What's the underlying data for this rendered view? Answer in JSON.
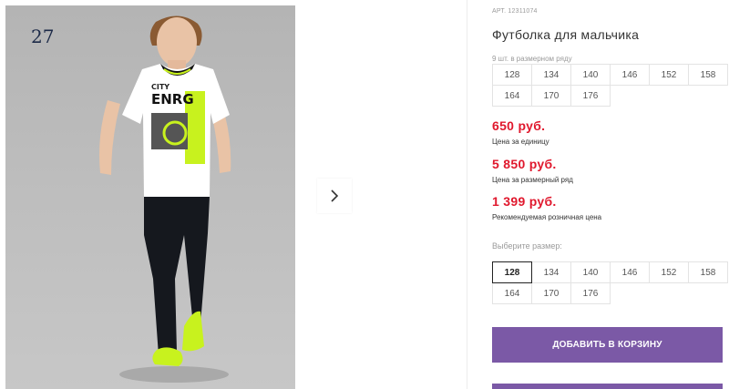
{
  "gallery": {
    "counter": "27",
    "shirt_print": "CITY ENRG"
  },
  "product": {
    "sku": "АРТ. 12311074",
    "title": "Футболка для мальчика",
    "row_note": "9 шт. в размерном ряду",
    "row_sizes": [
      "128",
      "134",
      "140",
      "146",
      "152",
      "158",
      "164",
      "170",
      "176"
    ],
    "prices": [
      {
        "value": "650 руб.",
        "label": "Цена за единицу"
      },
      {
        "value": "5 850 руб.",
        "label": "Цена за размерный ряд"
      },
      {
        "value": "1 399 руб.",
        "label": "Рекомендуемая розничная цена"
      }
    ],
    "choose_size_label": "Выберите размер:",
    "select_sizes": [
      "128",
      "134",
      "140",
      "146",
      "152",
      "158",
      "164",
      "170",
      "176"
    ],
    "selected_size": "128",
    "add_to_cart": "ДОБАВИТЬ В КОРЗИНУ"
  },
  "colors": {
    "price": "#e0182d",
    "button": "#7b59a6",
    "accent_neon": "#c8f21e"
  },
  "icons": {
    "next": "chevron-right-icon"
  }
}
